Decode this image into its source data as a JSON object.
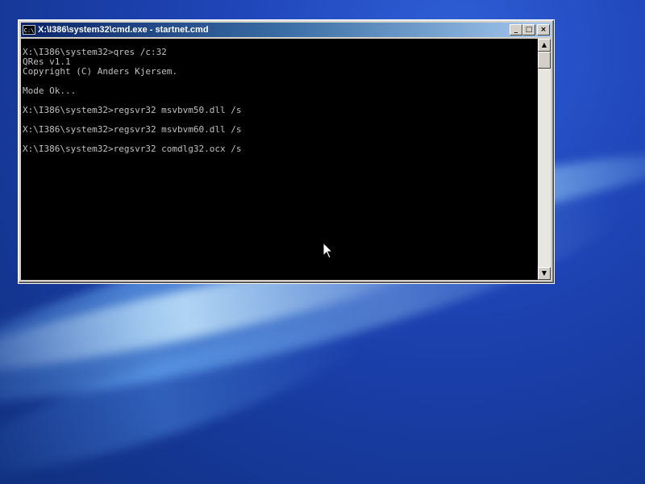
{
  "window": {
    "title": "X:\\I386\\system32\\cmd.exe - startnet.cmd",
    "app_icon_text": "C:\\",
    "buttons": {
      "minimize": "_",
      "maximize": "□",
      "close": "×"
    }
  },
  "console": {
    "lines": [
      "X:\\I386\\system32>qres /c:32",
      "QRes v1.1",
      "Copyright (C) Anders Kjersem.",
      "",
      "Mode Ok...",
      "",
      "X:\\I386\\system32>regsvr32 msvbvm50.dll /s",
      "",
      "X:\\I386\\system32>regsvr32 msvbvm60.dll /s",
      "",
      "X:\\I386\\system32>regsvr32 comdlg32.ocx /s"
    ]
  },
  "scrollbar": {
    "up_arrow": "▲",
    "down_arrow": "▼"
  },
  "colors": {
    "console_bg": "#000000",
    "console_fg": "#c0c0c0",
    "titlebar_start": "#0a246a",
    "titlebar_end": "#a6caf0",
    "desktop": "#1f45b8"
  }
}
